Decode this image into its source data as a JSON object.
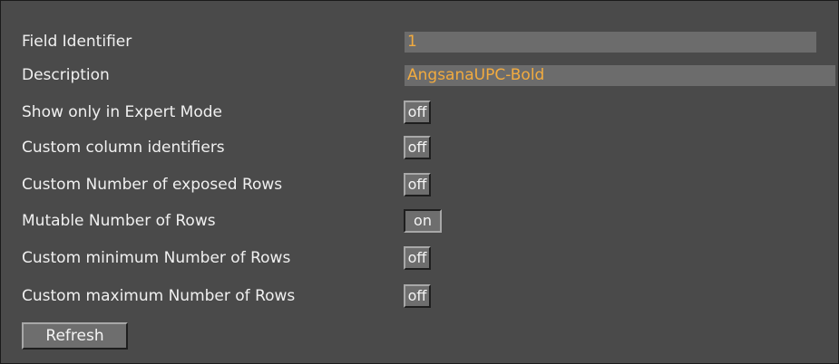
{
  "fields": {
    "field_identifier": {
      "label": "Field Identifier",
      "value": "1"
    },
    "description": {
      "label": "Description",
      "value": "AngsanaUPC-Bold"
    }
  },
  "toggles": [
    {
      "label": "Show only in Expert Mode",
      "state": "off"
    },
    {
      "label": "Custom column identifiers",
      "state": "off"
    },
    {
      "label": "Custom Number of exposed Rows",
      "state": "off"
    },
    {
      "label": "Mutable Number of Rows",
      "state": "on"
    },
    {
      "label": "Custom minimum Number of Rows",
      "state": "off"
    },
    {
      "label": "Custom maximum Number of Rows",
      "state": "off"
    }
  ],
  "refresh_label": "Refresh",
  "colors": {
    "background": "#4a4a4a",
    "field_background": "#6c6c6c",
    "value_text": "#f2ab3f",
    "label_text": "#f0f0f0"
  }
}
